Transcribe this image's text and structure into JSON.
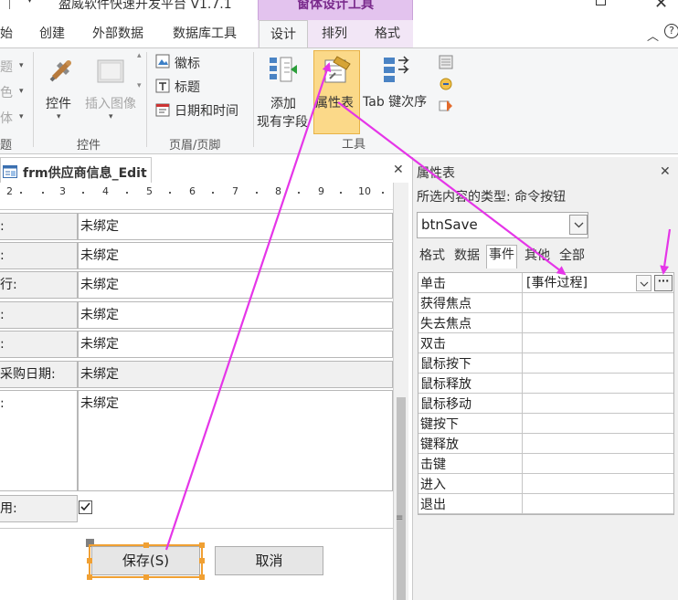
{
  "window": {
    "title": "盈威软件快速开发平台 V1.7.1",
    "context_group": "窗体设计工具"
  },
  "tabs": [
    {
      "label": "始"
    },
    {
      "label": "创建"
    },
    {
      "label": "外部数据"
    },
    {
      "label": "数据库工具"
    },
    {
      "label": "设计",
      "active": true
    },
    {
      "label": "排列"
    },
    {
      "label": "格式"
    }
  ],
  "ribbon": {
    "left_items": [
      "题",
      "色",
      "体"
    ],
    "left_group_label": "题",
    "controls": {
      "controls_label": "控件",
      "insert_image_label": "插入图像",
      "group_label": "控件"
    },
    "header_footer": {
      "logo_label": "徽标",
      "title_label": "标题",
      "datetime_label": "日期和时间",
      "group_label": "页眉/页脚"
    },
    "tools": {
      "add_fields_line1": "添加",
      "add_fields_line2": "现有字段",
      "property_sheet_label": "属性表",
      "tab_order_label": "Tab 键次序",
      "group_label": "工具"
    }
  },
  "document_tab": {
    "title": "frm供应商信息_Edit"
  },
  "ruler": {
    "numbers": [
      "2",
      "3",
      "4",
      "5",
      "6",
      "7",
      "8",
      "9",
      "10"
    ]
  },
  "form": {
    "rows": [
      {
        "label": ":",
        "value": "未绑定"
      },
      {
        "label": ":",
        "value": "未绑定"
      },
      {
        "label": "行:",
        "value": "未绑定"
      },
      {
        "label": ":",
        "value": "未绑定"
      },
      {
        "label": ":",
        "value": "未绑定"
      },
      {
        "label": "采购日期:",
        "value": "未绑定"
      },
      {
        "label": ":",
        "value": "未绑定"
      }
    ],
    "checkbox_label": "用:",
    "save_button_label": "保存(S)",
    "cancel_button_label": "取消"
  },
  "property_sheet": {
    "title": "属性表",
    "selection_type_label": "所选内容的类型: 命令按钮",
    "object_name": "btnSave",
    "tabs": [
      {
        "label": "格式"
      },
      {
        "label": "数据"
      },
      {
        "label": "事件",
        "active": true
      },
      {
        "label": "其他"
      },
      {
        "label": "全部"
      }
    ],
    "event_rows": [
      {
        "name": "单击",
        "value": "[事件过程]"
      },
      {
        "name": "获得焦点",
        "value": ""
      },
      {
        "name": "失去焦点",
        "value": ""
      },
      {
        "name": "双击",
        "value": ""
      },
      {
        "name": "鼠标按下",
        "value": ""
      },
      {
        "name": "鼠标释放",
        "value": ""
      },
      {
        "name": "鼠标移动",
        "value": ""
      },
      {
        "name": "键按下",
        "value": ""
      },
      {
        "name": "键释放",
        "value": ""
      },
      {
        "name": "击键",
        "value": ""
      },
      {
        "name": "进入",
        "value": ""
      },
      {
        "name": "退出",
        "value": ""
      }
    ],
    "builder_button_label": "···"
  },
  "colors": {
    "annotation_arrow": "#e535e8",
    "selection_outline": "#f0a033",
    "property_sheet_highlight": "#fbd989",
    "context_tab": "#e3c3ee"
  }
}
